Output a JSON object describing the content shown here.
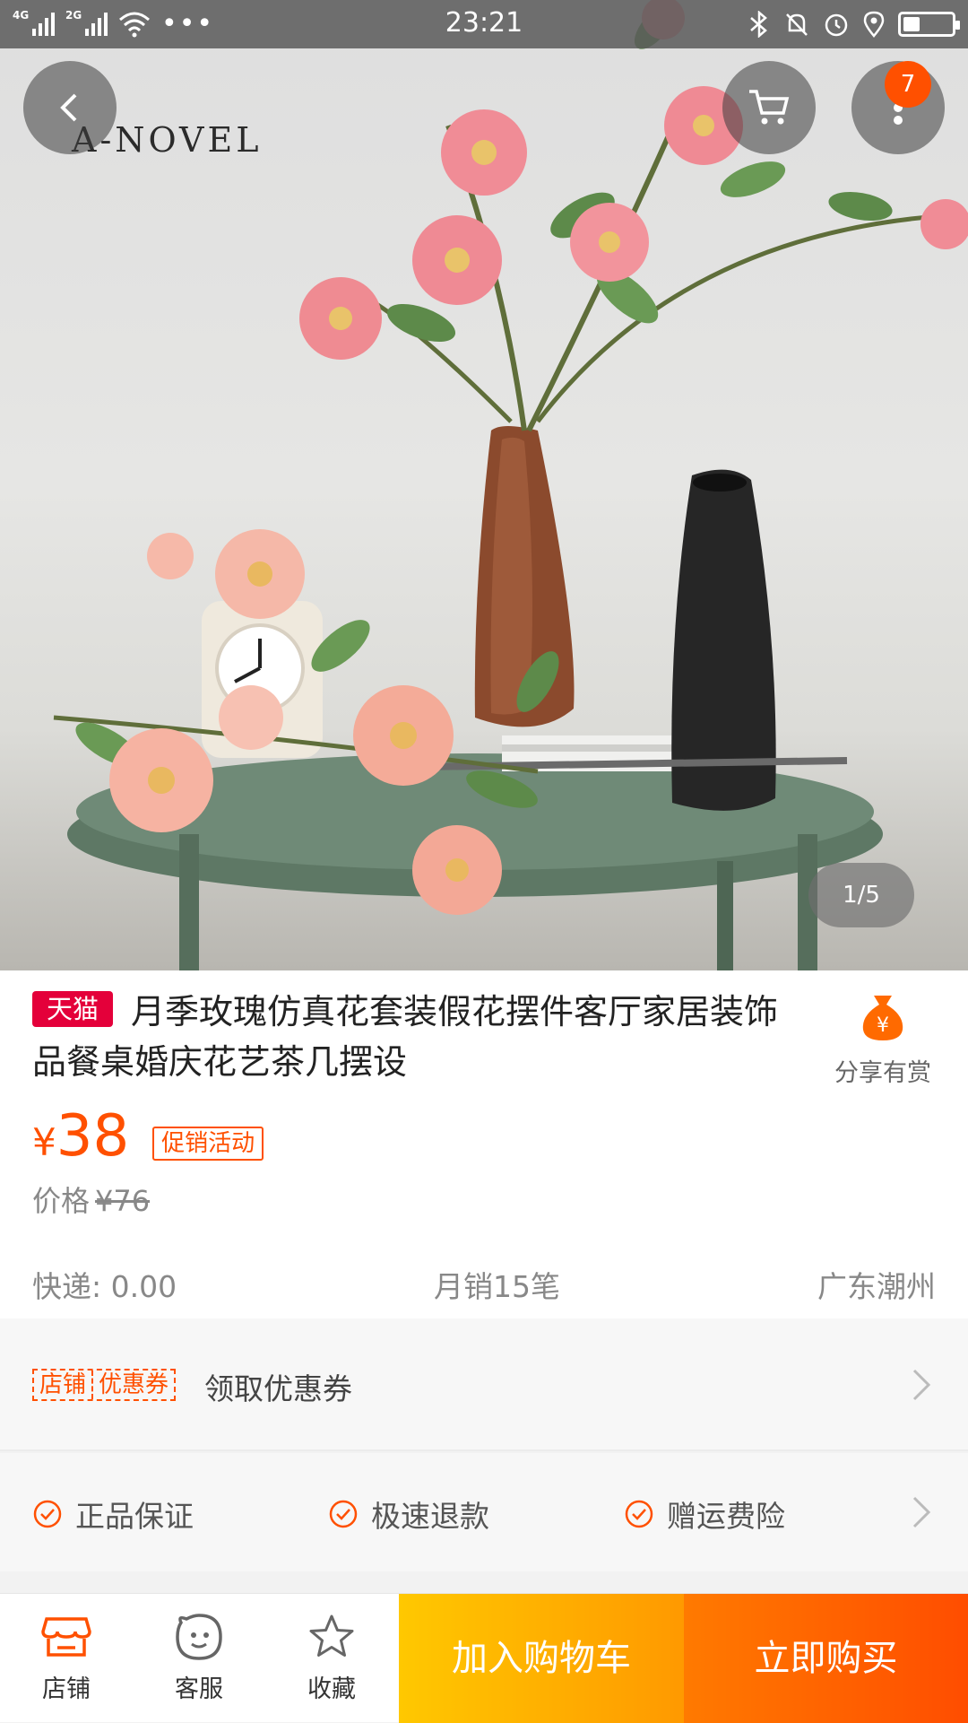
{
  "status_bar": {
    "network_1": "4G",
    "network_2": "2G",
    "time": "23:21",
    "battery_level": 0.35,
    "icons": [
      "signal-icon",
      "wifi-icon",
      "more-dots-icon",
      "bluetooth-icon",
      "bell-off-icon",
      "alarm-icon",
      "location-icon",
      "battery-icon"
    ]
  },
  "hero": {
    "brand_overlay": "A-NOVEL",
    "cart_badge": "7",
    "page_indicator": "1/5"
  },
  "product": {
    "platform_tag": "天猫",
    "title": "月季玫瑰仿真花套装假花摆件客厅家居装饰品餐桌婚庆花艺茶几摆设",
    "currency": "¥",
    "price": "38",
    "promo_label": "促销活动",
    "original_price_label": "价格",
    "original_price": "¥76",
    "shipping": "快递: 0.00",
    "monthly_sales": "月销15笔",
    "location": "广东潮州",
    "share_label": "分享有赏"
  },
  "coupon": {
    "tag_left": "店铺",
    "tag_right": "优惠券",
    "label": "领取优惠券"
  },
  "guarantees": [
    "正品保证",
    "极速退款",
    "赠运费险"
  ],
  "bottom_bar": {
    "store": "店铺",
    "service": "客服",
    "favorite": "收藏",
    "add_to_cart": "加入购物车",
    "buy_now": "立即购买"
  },
  "colors": {
    "accent": "#ff5000",
    "tmall_red": "#e4003a",
    "cart_gradient": [
      "#ffc800",
      "#ff9900"
    ],
    "buy_gradient": [
      "#ff7a00",
      "#ff4d00"
    ]
  }
}
